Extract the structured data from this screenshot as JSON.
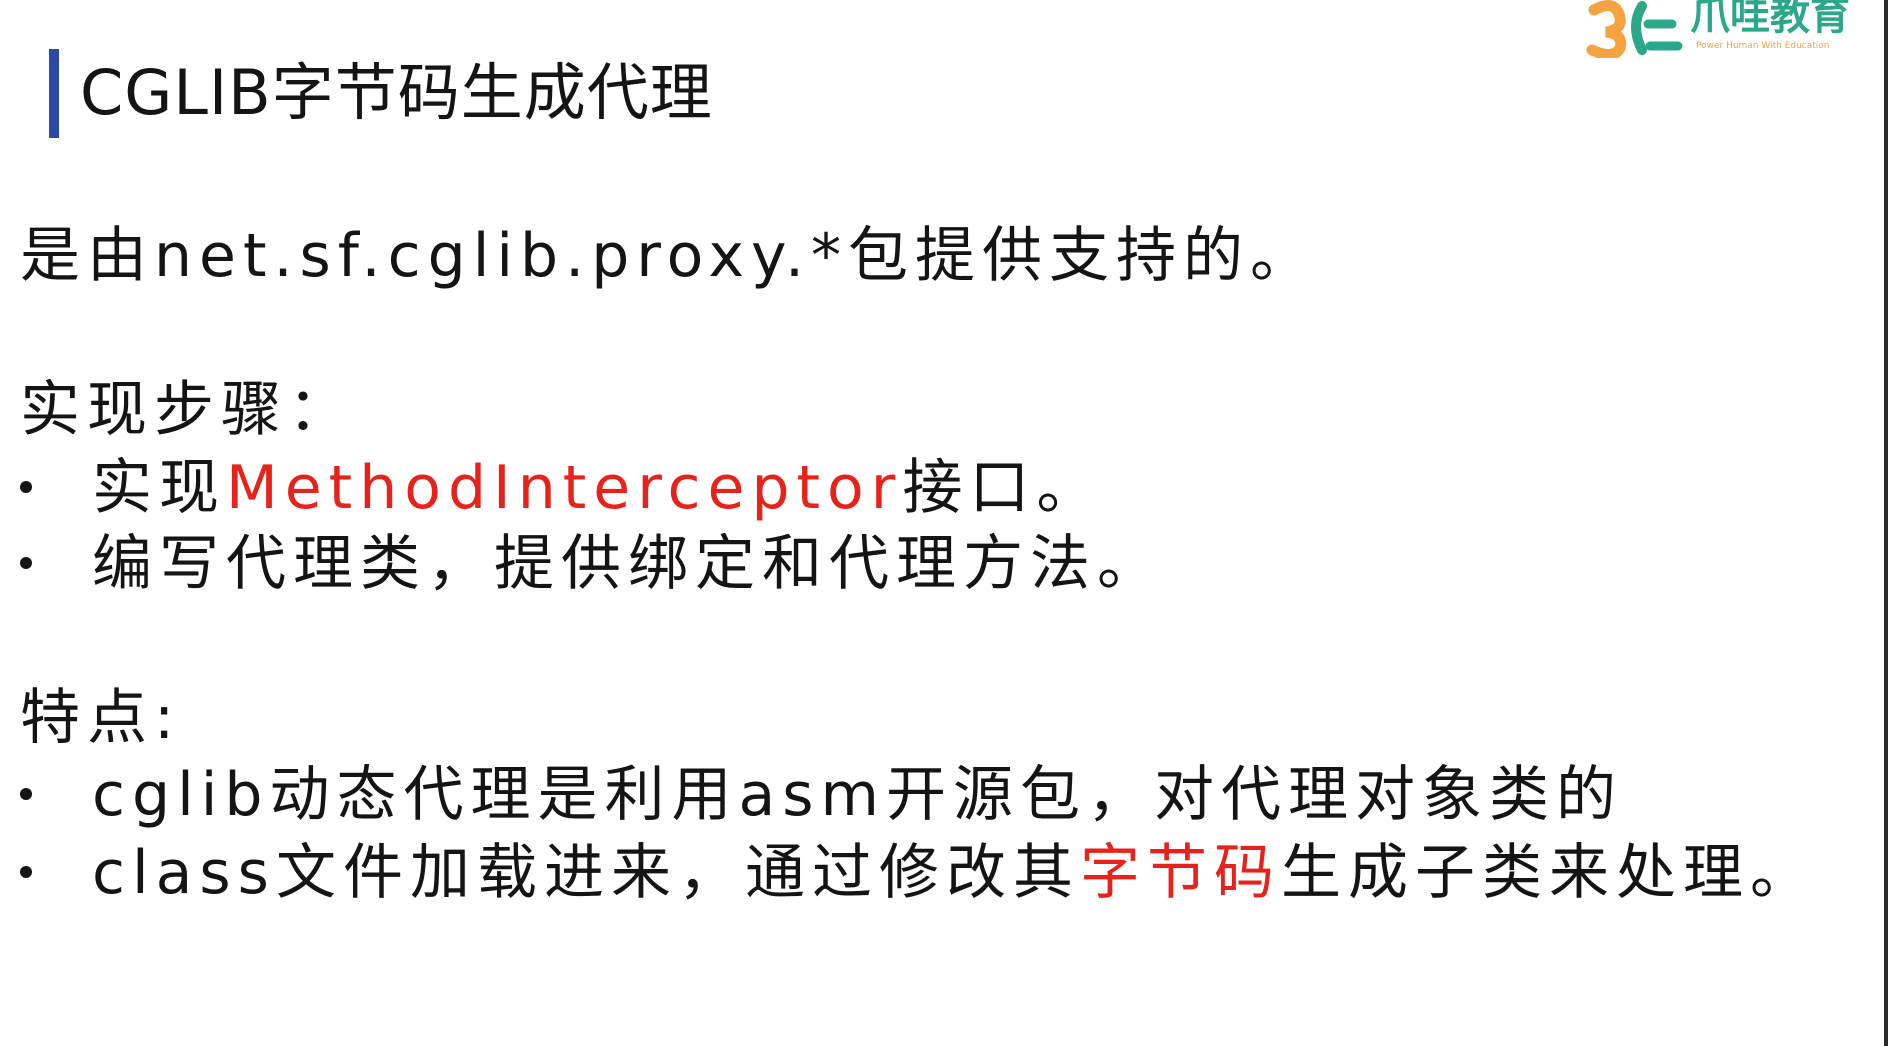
{
  "title": "CGLIB字节码生成代理",
  "logo": {
    "name": "爪哇教育",
    "slogan": "Power Human With Education"
  },
  "intro": "是由net.sf.cglib.proxy.*包提供支持的。",
  "steps": {
    "heading": "实现步骤：",
    "items": [
      {
        "before": "实现",
        "highlight": "MethodInterceptor",
        "after": "接口。"
      },
      {
        "text": "编写代理类，提供绑定和代理方法。"
      }
    ]
  },
  "features": {
    "heading": "特点:",
    "items": [
      {
        "text": "cglib动态代理是利用asm开源包，对代理对象类的"
      },
      {
        "before": "class文件加载进来，通过修改其",
        "highlight": "字节码",
        "after": "生成子类来处理。"
      }
    ]
  },
  "colors": {
    "accent_bar": "#2b4aa6",
    "highlight": "#e8221b",
    "logo_green": "#2aa889",
    "logo_orange": "#f4a340"
  }
}
